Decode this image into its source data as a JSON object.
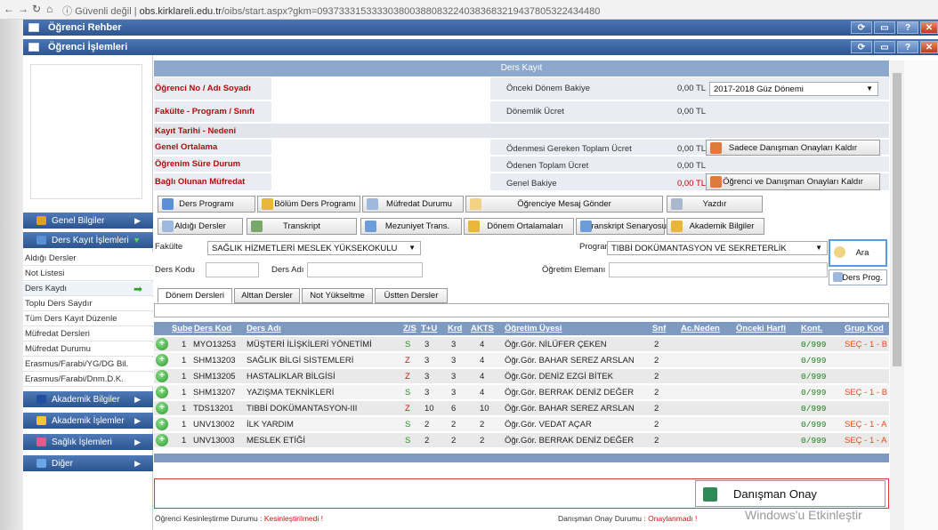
{
  "browser": {
    "security": "Güvenli değil",
    "host": "obs.kirklareli.edu.tr",
    "path": "/oibs/start.aspx?gkm=0937333153333038003880832240383683219437805322434480"
  },
  "windows": {
    "outer_title": "Öğrenci Rehber",
    "inner_title": "Öğrenci İşlemleri"
  },
  "sidebar": {
    "heads": [
      {
        "label": "Genel Bilgiler",
        "icon": "house-icon",
        "color": "#e0a020"
      },
      {
        "label": "Ders Kayıt İşlemleri",
        "icon": "book-icon",
        "color": "#5b8fd6"
      },
      {
        "label": "Akademik Bilgiler",
        "icon": "graduation-icon",
        "color": "#224e9e"
      },
      {
        "label": "Akademik İşlemler",
        "icon": "star-icon",
        "color": "#f3c433"
      },
      {
        "label": "Sağlık İşlemleri",
        "icon": "heart-icon",
        "color": "#e35b8c"
      },
      {
        "label": "Diğer",
        "icon": "window-icon",
        "color": "#6aa7e6"
      }
    ],
    "links": [
      "Aldığı Dersler",
      "Not Listesi",
      "Ders Kaydı",
      "Toplu Ders Saydır",
      "Tüm Ders Kayıt Düzenle",
      "Müfredat Dersleri",
      "Müfredat Durumu",
      "Erasmus/Farabi/YG/DG Bil.",
      "Erasmus/Farabi/Dnm.D.K."
    ]
  },
  "header": {
    "title": "Ders Kayıt"
  },
  "info": {
    "left": [
      "Öğrenci No / Adı Soyadı",
      "Fakülte - Program / Sınıfı",
      "Kayıt Tarihi - Nedeni",
      "Genel Ortalama",
      "Öğrenim Süre Durum",
      "Bağlı Olunan Müfredat"
    ],
    "right": [
      {
        "label": "Önceki Dönem Bakiye",
        "value": "0,00 TL"
      },
      {
        "label": "Dönemlik Ücret",
        "value": "0,00 TL"
      },
      {
        "label": "",
        "value": ""
      },
      {
        "label": "Ödenmesi Gereken Toplam Ücret",
        "value": "0,00 TL"
      },
      {
        "label": "Ödenen Toplam Ücret",
        "value": "0,00 TL"
      },
      {
        "label": "Genel Bakiye",
        "value": "0,00 TL"
      }
    ],
    "term_select": "2017-2018 Güz Dönemi",
    "btn_remove_advisor": "Sadece Danışman Onayları Kaldır",
    "btn_remove_both": "Öğrenci ve Danışman Onayları Kaldır"
  },
  "toolbar": {
    "row1": [
      "Ders Programı",
      "Bölüm Ders Programı",
      "Müfredat Durumu",
      "Öğrenciye Mesaj Gönder",
      "Yazdır"
    ],
    "row2": [
      "Aldığı Dersler",
      "Transkript",
      "Mezuniyet Trans.",
      "Dönem Ortalamaları",
      "Transkript Senaryosu",
      "Akademik Bilgiler"
    ]
  },
  "filters": {
    "faculty_label": "Fakülte",
    "faculty_value": "SAĞLIK HİZMETLERİ MESLEK YÜKSEKOKULU",
    "program_label": "Program",
    "program_value": "TIBBİ DOKÜMANTASYON VE SEKRETERLİK",
    "code_label": "Ders Kodu",
    "name_label": "Ders Adı",
    "teacher_label": "Öğretim Elemanı",
    "search_btn": "Ara",
    "prog_btn": "Ders Prog."
  },
  "tabs": [
    "Dönem Dersleri",
    "Alttan Dersler",
    "Not Yükseltme",
    "Üstten Dersler"
  ],
  "grid": {
    "headers": [
      "Şube",
      "Ders Kod",
      "Ders Adı",
      "Z/S",
      "T+U",
      "Krd",
      "AKTS",
      "Öğretim Üyesi",
      "Snf",
      "Ac.Neden",
      "Önceki Harfi",
      "Kont.",
      "Grup Kod"
    ],
    "rows": [
      {
        "sube": "1",
        "kod": "MYO13253",
        "ad": "MÜŞTERİ İLİŞKİLERİ YÖNETİMİ",
        "zs": "S",
        "tu": "3",
        "krd": "3",
        "akts": "4",
        "hoca": "Öğr.Gör. NİLÜFER ÇEKEN",
        "snf": "2",
        "kont": "0/999",
        "grup": "SEÇ - 1 - B"
      },
      {
        "sube": "1",
        "kod": "SHM13203",
        "ad": "SAĞLIK BİLGİ SİSTEMLERİ",
        "zs": "Z",
        "tu": "3",
        "krd": "3",
        "akts": "4",
        "hoca": "Öğr.Gör. BAHAR SEREZ ARSLAN",
        "snf": "2",
        "kont": "0/999",
        "grup": ""
      },
      {
        "sube": "1",
        "kod": "SHM13205",
        "ad": "HASTALIKLAR BİLGİSİ",
        "zs": "Z",
        "tu": "3",
        "krd": "3",
        "akts": "4",
        "hoca": "Öğr.Gör. DENİZ EZGİ BİTEK",
        "snf": "2",
        "kont": "0/999",
        "grup": ""
      },
      {
        "sube": "1",
        "kod": "SHM13207",
        "ad": "YAZIŞMA TEKNİKLERİ",
        "zs": "S",
        "tu": "3",
        "krd": "3",
        "akts": "4",
        "hoca": "Öğr.Gör. BERRAK DENİZ DEĞER",
        "snf": "2",
        "kont": "0/999",
        "grup": "SEÇ - 1 - B"
      },
      {
        "sube": "1",
        "kod": "TDS13201",
        "ad": "TIBBİ DOKÜMANTASYON-III",
        "zs": "Z",
        "tu": "10",
        "krd": "6",
        "akts": "10",
        "hoca": "Öğr.Gör. BAHAR SEREZ ARSLAN",
        "snf": "2",
        "kont": "0/999",
        "grup": ""
      },
      {
        "sube": "1",
        "kod": "UNV13002",
        "ad": "İLK YARDIM",
        "zs": "S",
        "tu": "2",
        "krd": "2",
        "akts": "2",
        "hoca": "Öğr.Gör. VEDAT AÇAR",
        "snf": "2",
        "kont": "0/999",
        "grup": "SEÇ - 1 - A"
      },
      {
        "sube": "1",
        "kod": "UNV13003",
        "ad": "MESLEK ETİĞİ",
        "zs": "S",
        "tu": "2",
        "krd": "2",
        "akts": "2",
        "hoca": "Öğr.Gör. BERRAK DENİZ DEĞER",
        "snf": "2",
        "kont": "0/999",
        "grup": "SEÇ - 1 - A"
      }
    ]
  },
  "footer": {
    "advisor_btn": "Danışman Onay",
    "student_label": "Öğrenci Kesinleştirme Durumu :",
    "student_value": "Kesinleştirilmedi !",
    "advisor_label": "Danışman Onay Durumu :",
    "advisor_value": "Onaylanmadı !",
    "watermark": "Windows'u Etkinleştir"
  }
}
